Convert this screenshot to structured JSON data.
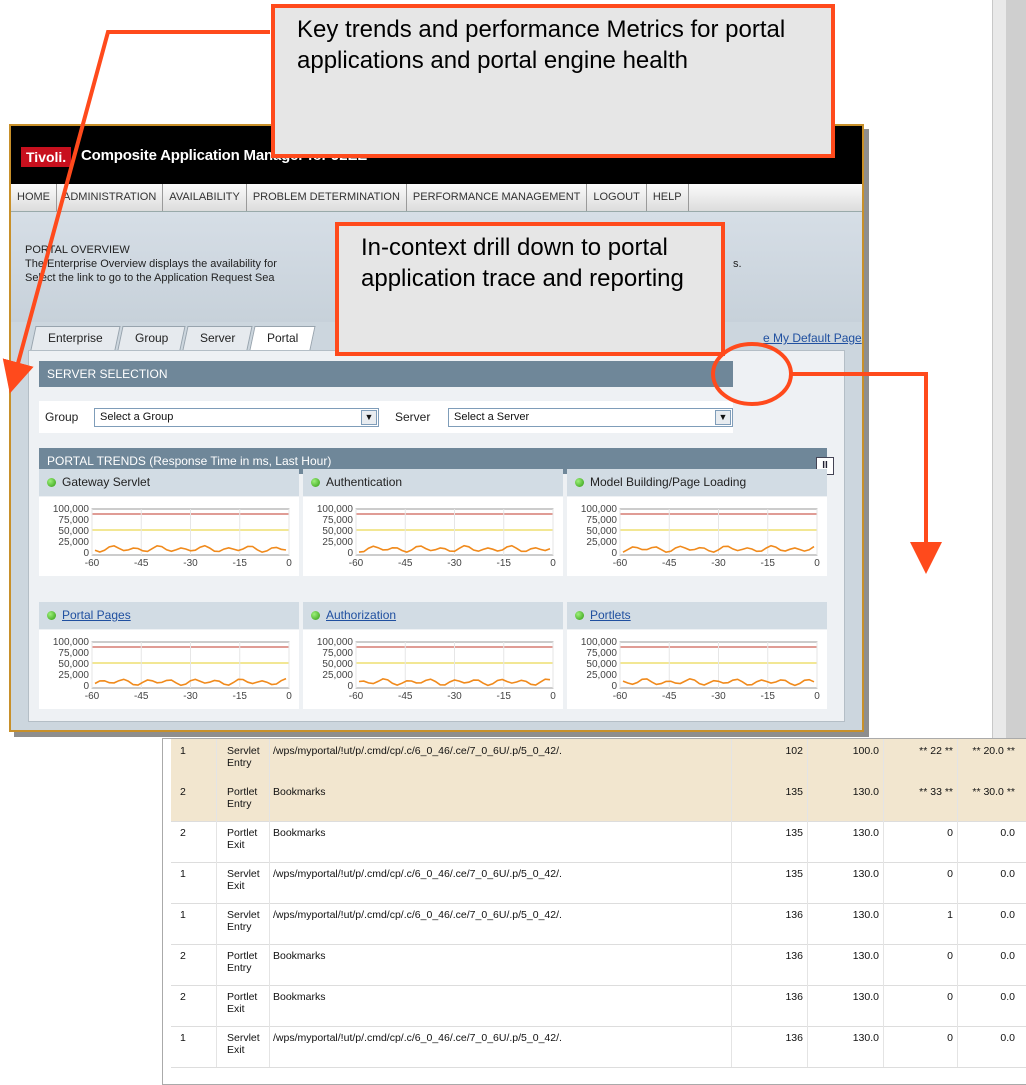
{
  "app": {
    "brand": "Tivoli.",
    "title": "Composite Application Manager for J2EE",
    "nav": [
      "HOME",
      "ADMINISTRATION",
      "AVAILABILITY",
      "PROBLEM DETERMINATION",
      "PERFORMANCE MANAGEMENT",
      "LOGOUT",
      "HELP"
    ],
    "overview_title": "PORTAL OVERVIEW",
    "overview_line1": "The Enterprise Overview displays the availability for",
    "overview_line1_tail": "s.",
    "overview_line2": "Select the link to go to the Application Request Sea",
    "tabs": [
      "Enterprise",
      "Group",
      "Server",
      "Portal"
    ],
    "default_link": "e My Default Page",
    "server_selection": {
      "title": "SERVER SELECTION",
      "group_label": "Group",
      "group_value": "Select a Group",
      "server_label": "Server",
      "server_value": "Select a Server"
    },
    "trends_title": "PORTAL TRENDS (Response Time in ms, Last Hour)",
    "trend_icon": "tools-icon",
    "charts": [
      {
        "name": "Gateway Servlet",
        "link": false
      },
      {
        "name": "Authentication",
        "link": false
      },
      {
        "name": "Model Building/Page Loading",
        "link": false
      },
      {
        "name": "Portal Pages",
        "link": true
      },
      {
        "name": "Authorization",
        "link": true
      },
      {
        "name": "Portlets",
        "link": true
      }
    ],
    "y_ticks": [
      "100,000",
      "75,000",
      "50,000",
      "25,000",
      "0"
    ],
    "x_ticks": [
      "-60",
      "-45",
      "-30",
      "-15",
      "0"
    ],
    "status_color": "#3aa515"
  },
  "table": {
    "rows": [
      {
        "level": "1",
        "type": "Servlet Entry",
        "name": "/wps/myportal/!ut/p/.cmd/cp/.c/6_0_46/.ce/7_0_6U/.p/5_0_42/.",
        "a": "102",
        "b": "100.0",
        "c": "** 22 **",
        "d": "** 20.0 **",
        "hl": true
      },
      {
        "level": "2",
        "type": "Portlet Entry",
        "name": "Bookmarks",
        "a": "135",
        "b": "130.0",
        "c": "** 33 **",
        "d": "** 30.0 **",
        "hl": true
      },
      {
        "level": "2",
        "type": "Portlet Exit",
        "name": "Bookmarks",
        "a": "135",
        "b": "130.0",
        "c": "0",
        "d": "0.0",
        "hl": false
      },
      {
        "level": "1",
        "type": "Servlet Exit",
        "name": "/wps/myportal/!ut/p/.cmd/cp/.c/6_0_46/.ce/7_0_6U/.p/5_0_42/.",
        "a": "135",
        "b": "130.0",
        "c": "0",
        "d": "0.0",
        "hl": false
      },
      {
        "level": "1",
        "type": "Servlet Entry",
        "name": "/wps/myportal/!ut/p/.cmd/cp/.c/6_0_46/.ce/7_0_6U/.p/5_0_42/.",
        "a": "136",
        "b": "130.0",
        "c": "1",
        "d": "0.0",
        "hl": false
      },
      {
        "level": "2",
        "type": "Portlet Entry",
        "name": "Bookmarks",
        "a": "136",
        "b": "130.0",
        "c": "0",
        "d": "0.0",
        "hl": false
      },
      {
        "level": "2",
        "type": "Portlet Exit",
        "name": "Bookmarks",
        "a": "136",
        "b": "130.0",
        "c": "0",
        "d": "0.0",
        "hl": false
      },
      {
        "level": "1",
        "type": "Servlet Exit",
        "name": "/wps/myportal/!ut/p/.cmd/cp/.c/6_0_46/.ce/7_0_6U/.p/5_0_42/.",
        "a": "136",
        "b": "130.0",
        "c": "0",
        "d": "0.0",
        "hl": false
      }
    ]
  },
  "callouts": {
    "top": "Key trends and performance Metrics for portal applications and portal engine health",
    "middle": "In-context drill down to portal application trace and reporting",
    "accent": "#ff4a1c"
  }
}
